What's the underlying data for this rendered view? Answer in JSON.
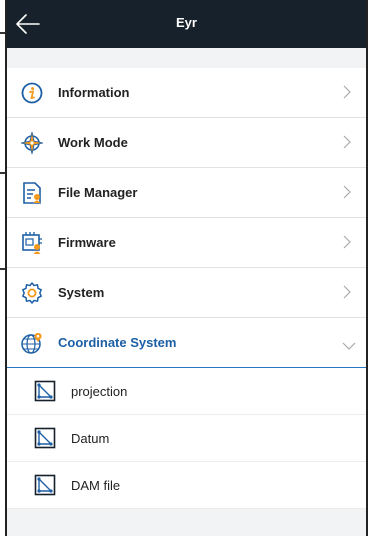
{
  "header": {
    "title": "Eyr",
    "back_icon": "arrow-left-icon"
  },
  "menu": [
    {
      "label": "Information",
      "icon": "info-circle-icon"
    },
    {
      "label": "Work Mode",
      "icon": "compass-star-icon"
    },
    {
      "label": "File Manager",
      "icon": "file-manager-icon"
    },
    {
      "label": "Firmware",
      "icon": "firmware-chip-icon"
    },
    {
      "label": "System",
      "icon": "gear-icon"
    },
    {
      "label": "Coordinate System",
      "icon": "globe-pin-icon",
      "expanded": true
    }
  ],
  "submenu": [
    {
      "label": "projection",
      "icon": "projection-icon"
    },
    {
      "label": "Datum",
      "icon": "projection-icon"
    },
    {
      "label": "DAM file",
      "icon": "projection-icon"
    }
  ],
  "colors": {
    "header_bg": "#17212b",
    "accent": "#1d5fa5",
    "icon_orange": "#f39a1e",
    "icon_blue": "#1d5fa5"
  }
}
